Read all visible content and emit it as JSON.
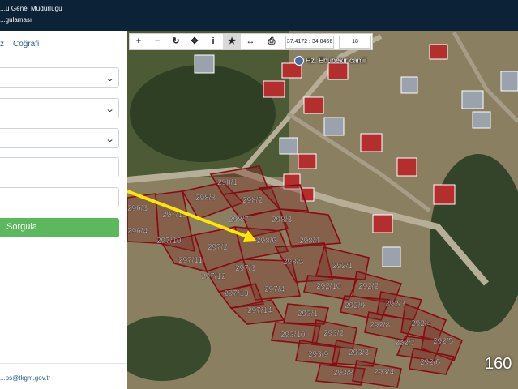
{
  "header": {
    "title_line1": "...u Genel Müdürlüğü",
    "title_line2": "...gulaması"
  },
  "sidebar": {
    "tab_left": "z",
    "tab_right": "Coğrafi",
    "query_button": "Sorgula",
    "email": "...ps@tkgm.gov.tr"
  },
  "toolbar": {
    "coordinates": "37.4172 : 34.8466",
    "zoom_level": "18",
    "icons": [
      "plus-icon",
      "minus-icon",
      "refresh-icon",
      "crosshair-icon",
      "info-icon",
      "star-icon",
      "measure-icon",
      "print-icon"
    ]
  },
  "map": {
    "poi_label": "Hz. Ebubekir camii",
    "scale_fragment": "160",
    "parcels": [
      "298/1",
      "298/8",
      "298/2",
      "297/15",
      "298/7",
      "298/3",
      "296/3",
      "296/4",
      "297/10",
      "297/2",
      "298/6",
      "298/4",
      "297/11",
      "298/5",
      "297/3",
      "297/12",
      "297/4",
      "292/1",
      "297/13",
      "292/10",
      "292/2",
      "297/14",
      "292/9",
      "292/3",
      "293/1",
      "292/8",
      "292/4",
      "293/10",
      "293/2",
      "292/7",
      "292/5",
      "293/9",
      "293/3",
      "292/6",
      "293/8",
      "293/4"
    ]
  },
  "colors": {
    "header_bg": "#0c2237",
    "query_button": "#5cb85c",
    "parcel_outline": "#8a0a14",
    "arrow": "#ffe600"
  }
}
